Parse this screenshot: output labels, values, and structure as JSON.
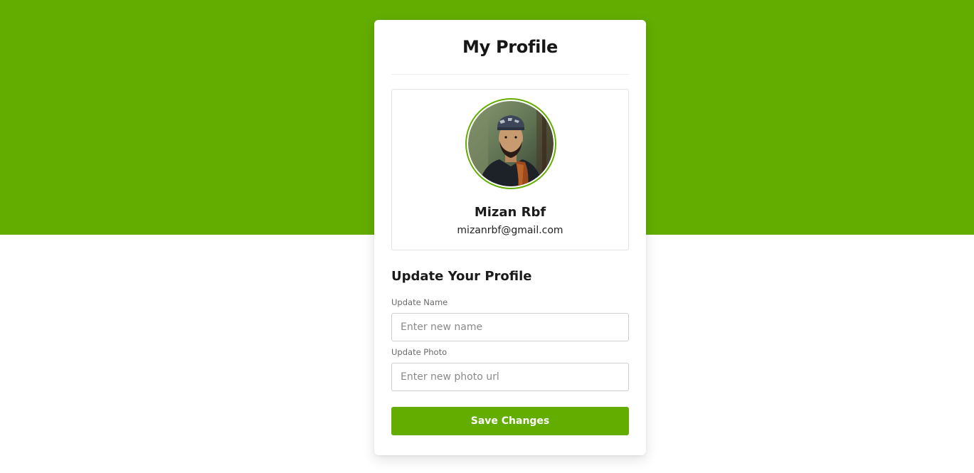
{
  "colors": {
    "brand_green": "#63AD00",
    "text_dark": "#161616"
  },
  "card": {
    "title": "My Profile"
  },
  "profile": {
    "name": "Mizan Rbf",
    "email": "mizanrbf@gmail.com"
  },
  "form": {
    "section_title": "Update Your Profile",
    "name_label": "Update Name",
    "name_placeholder": "Enter new name",
    "name_value": "",
    "photo_label": "Update Photo",
    "photo_placeholder": "Enter new photo url",
    "photo_value": "",
    "save_label": "Save Changes"
  }
}
